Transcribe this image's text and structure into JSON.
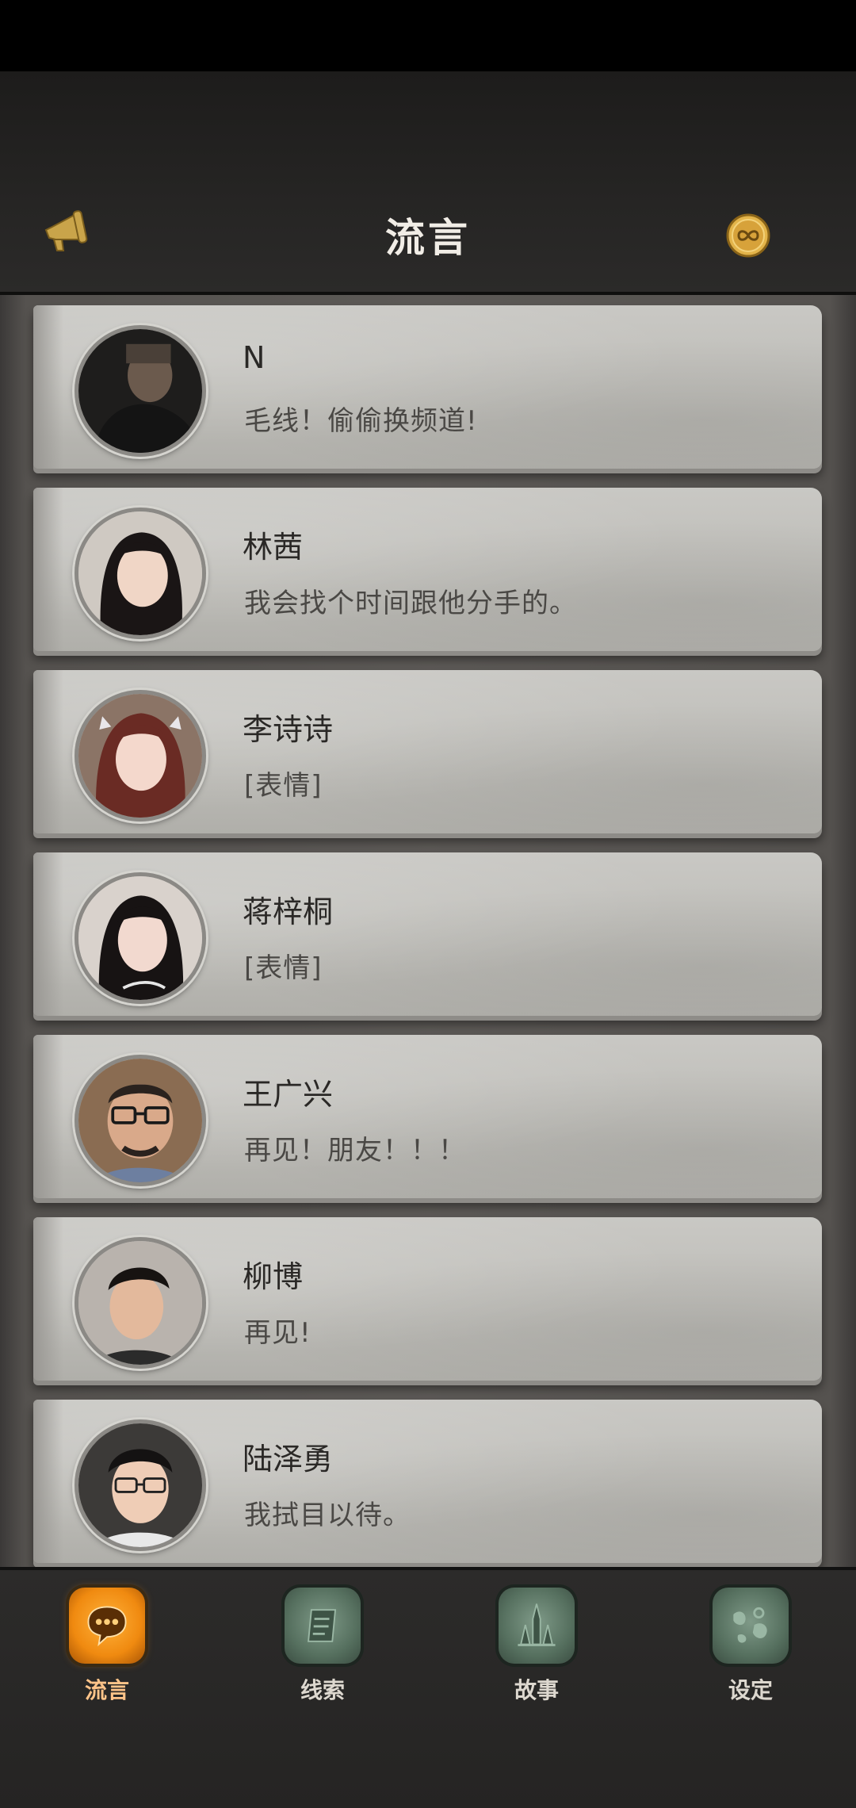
{
  "header": {
    "title": "流言",
    "left_icon": "megaphone-icon",
    "right_icon": "infinity-coin-icon",
    "accent_color": "#d4a23a"
  },
  "messages": [
    {
      "name": "N",
      "text": "毛线！偷偷换频道!"
    },
    {
      "name": "林茜",
      "text": "我会找个时间跟他分手的。"
    },
    {
      "name": "李诗诗",
      "text": "[表情]"
    },
    {
      "name": "蒋梓桐",
      "text": "[表情]"
    },
    {
      "name": "王广兴",
      "text": "再见！朋友！！！"
    },
    {
      "name": "柳博",
      "text": "再见!"
    },
    {
      "name": "陆泽勇",
      "text": "我拭目以待。"
    }
  ],
  "nav": [
    {
      "label": "流言",
      "icon": "chat-bubble-icon",
      "active": true
    },
    {
      "label": "线索",
      "icon": "scroll-icon",
      "active": false
    },
    {
      "label": "故事",
      "icon": "cathedral-icon",
      "active": false
    },
    {
      "label": "设定",
      "icon": "settings-map-icon",
      "active": false
    }
  ]
}
